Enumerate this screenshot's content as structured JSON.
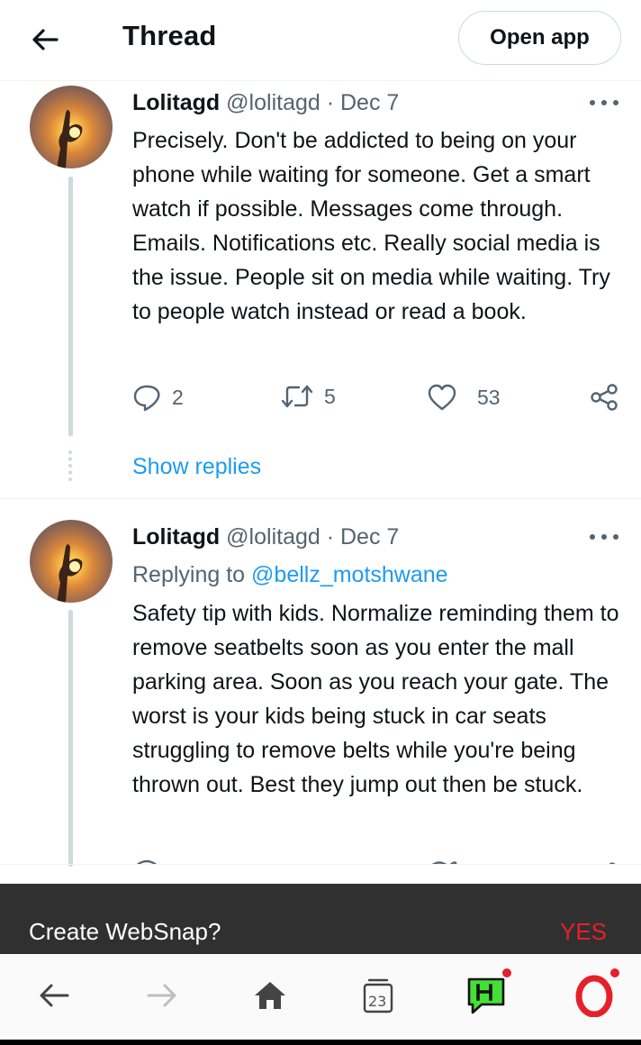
{
  "header": {
    "title": "Thread",
    "open_app_label": "Open app"
  },
  "tweets": [
    {
      "name": "Lolitagd",
      "handle": "@lolitagd",
      "dot": " · ",
      "date": "Dec 7",
      "text": "Precisely. Don't be addicted to being on your phone while waiting for someone. Get a smart watch if possible. Messages come through. Emails. Notifications etc. Really social media is the issue. People sit on media while waiting. Try to people watch instead or read a book.",
      "replies": "2",
      "retweets": "5",
      "likes": "53",
      "show_replies": "Show replies"
    },
    {
      "name": "Lolitagd",
      "handle": "@lolitagd",
      "dot": " · ",
      "date": "Dec 7",
      "replying_prefix": "Replying to ",
      "replying_to": "@bellz_motshwane",
      "text": "Safety tip with kids. Normalize reminding them to remove seatbelts soon as you enter the mall parking area. Soon as you reach your gate. The worst is your kids being stuck in car seats struggling to remove belts while you're being thrown out. Best they jump out then be stuck."
    }
  ],
  "snackbar": {
    "text": "Create WebSnap?",
    "action": "YES"
  },
  "bottom_nav": {
    "tabs_count": "23",
    "icons": [
      "back-arrow-icon",
      "forward-arrow-icon",
      "home-icon",
      "tabs-icon",
      "hype-icon",
      "opera-icon"
    ]
  },
  "colors": {
    "link_blue": "#1d9bf0",
    "secondary_text": "#536471",
    "snackbar_bg": "#303030",
    "accent_red": "#e6202b",
    "hype_green": "#45e035"
  }
}
